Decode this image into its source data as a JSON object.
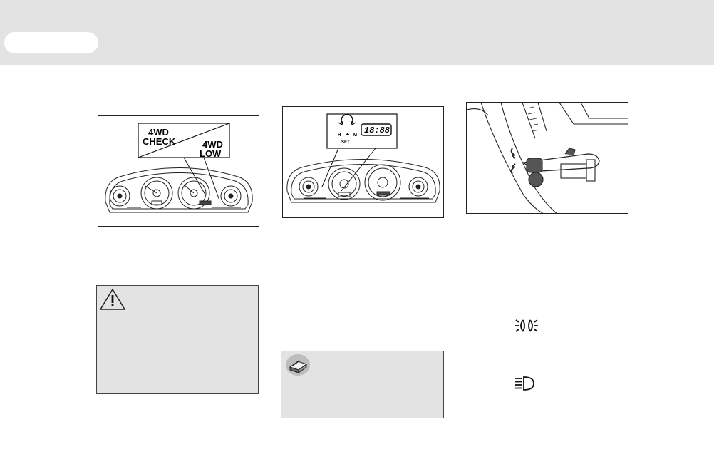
{
  "figure1": {
    "label_check": "4WD\nCHECK",
    "label_low": "4WD\nLOW"
  },
  "figure2": {
    "clock_display": "18:88",
    "knob_labels": {
      "h": "H",
      "m": "M",
      "set": "SET"
    }
  },
  "icons": {
    "warning": "warning-triangle-icon",
    "note": "note-book-icon",
    "parking_light": "parking-light-icon",
    "headlight": "headlight-icon"
  },
  "colors": {
    "header_band": "#e3e3e3",
    "note_box": "#e3e3e3",
    "line_art": "#222222"
  }
}
